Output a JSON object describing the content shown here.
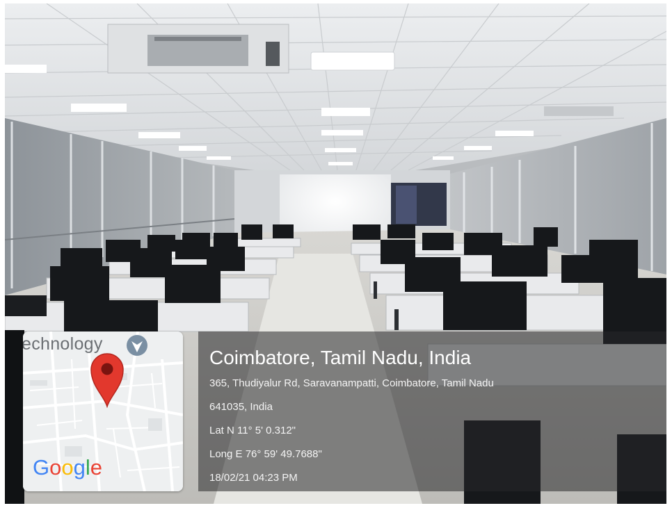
{
  "photo": {
    "subject": "computer-lab-room",
    "colors": {
      "ceiling": "#e4e6e8",
      "desk": "#e9eaec",
      "monitor": "#16181b",
      "floor": "#c9c8c4",
      "screen": "#f4f5f6"
    }
  },
  "map": {
    "partial_label": "echnology",
    "logo_text": "Google",
    "logo_colors": [
      "#4285f4",
      "#ea4335",
      "#fbbc05",
      "#4285f4",
      "#34a853",
      "#ea4335"
    ],
    "pin_color": "#e2382d",
    "icons": [
      "map-pin-icon",
      "navigation-icon"
    ]
  },
  "location": {
    "title": "Coimbatore, Tamil Nadu, India",
    "address_line1": "365, Thudiyalur Rd, Saravanampatti, Coimbatore, Tamil Nadu",
    "address_line2": "641035, India",
    "latitude": "Lat N 11° 5' 0.312\"",
    "longitude": "Long E 76° 59' 49.7688\"",
    "timestamp": "18/02/21 04:23 PM"
  }
}
